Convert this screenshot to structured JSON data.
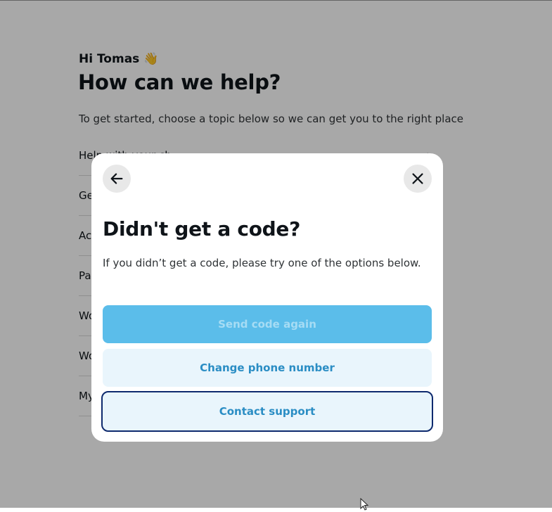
{
  "background": {
    "greeting": "Hi Tomas 👋",
    "title": "How can we help?",
    "subtitle": "To get started, choose a topic below so we can get you to the right place",
    "topics": [
      {
        "label": "Help with your ch"
      },
      {
        "label": "Ge"
      },
      {
        "label": "Ac"
      },
      {
        "label": "Pa"
      },
      {
        "label": "Wo"
      },
      {
        "label": "Wo"
      },
      {
        "label": "My"
      }
    ]
  },
  "modal": {
    "back_icon": "arrow-left-icon",
    "close_icon": "close-icon",
    "title": "Didn't get a code?",
    "description": "If you didn’t get a code, please try one of the options below.",
    "buttons": {
      "send_again": "Send code again",
      "change_phone": "Change phone number",
      "contact_support": "Contact support"
    }
  },
  "colors": {
    "overlay": "rgba(0,0,0,0.34)",
    "primary_disabled": "#5bbdea",
    "secondary_bg": "#e9f5fc",
    "link_text": "#2a8dc4",
    "focus_ring": "#0e2a6e"
  }
}
